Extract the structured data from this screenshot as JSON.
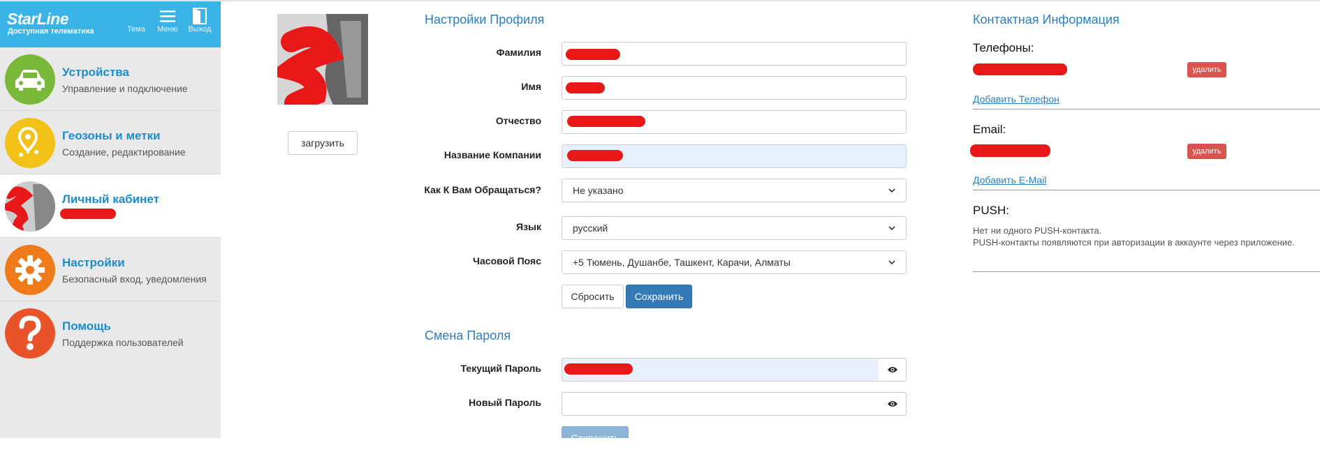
{
  "header": {
    "logo": "StarLine",
    "tagline": "Доступная телематика",
    "buttons": [
      {
        "icon": "moon-icon",
        "label": "Тема"
      },
      {
        "icon": "menu-icon",
        "label": "Меню"
      },
      {
        "icon": "exit-icon",
        "label": "Выход"
      }
    ]
  },
  "sidebar": {
    "items": [
      {
        "title": "Устройства",
        "subtitle": "Управление и подключение",
        "icon": "car-icon",
        "color": "#7ab83a"
      },
      {
        "title": "Геозоны и метки",
        "subtitle": "Создание, редактирование",
        "icon": "geozone-icon",
        "color": "#f2c219"
      },
      {
        "title": "Личный кабинет",
        "subtitle": "",
        "icon": "avatar",
        "color": "#cccccc",
        "active": true
      },
      {
        "title": "Настройки",
        "subtitle": "Безопасный вход, уведомления",
        "icon": "gear-icon",
        "color": "#f07a1a"
      },
      {
        "title": "Помощь",
        "subtitle": "Поддержка пользователей",
        "icon": "question-icon",
        "color": "#e8532a"
      }
    ]
  },
  "avatar": {
    "upload_label": "загрузить"
  },
  "profile": {
    "title": "Настройки Профиля",
    "fields": {
      "last_name": "Фамилия",
      "first_name": "Имя",
      "patronymic": "Отчество",
      "company": "Название Компании",
      "salutation": "Как К Вам Обращаться?",
      "language": "Язык",
      "timezone": "Часовой Пояс"
    },
    "salutation_value": "Не указано",
    "language_value": "русский",
    "timezone_value": "+5 Тюмень, Душанбе, Ташкент, Карачи, Алматы",
    "reset_label": "Сбросить",
    "save_label": "Сохранить"
  },
  "password": {
    "title": "Смена Пароля",
    "current_label": "Текущий Пароль",
    "new_label": "Новый Пароль",
    "save_label": "Сохранить"
  },
  "contacts": {
    "title": "Контактная Информация",
    "phones_label": "Телефоны:",
    "delete_label": "удалить",
    "add_phone": "Добавить Телефон",
    "email_label": "Email:",
    "add_email": "Добавить E-Mail",
    "push_label": "PUSH:",
    "push_empty": "Нет ни одного PUSH-контакта.",
    "push_hint": "PUSH-контакты появляются при авторизации в аккаунте через приложение."
  },
  "colors": {
    "accent": "#3ab4e7",
    "link": "#2b7fbf",
    "primary": "#337ab7",
    "danger": "#d9534f",
    "redaction": "#e81818"
  }
}
